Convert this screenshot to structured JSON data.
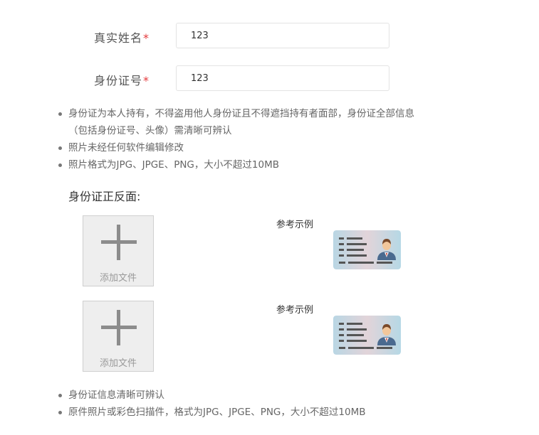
{
  "form": {
    "name_label": "真实姓名",
    "name_value": "123",
    "id_label": "身份证号",
    "id_value": "123",
    "required_mark": "*"
  },
  "notes_top": [
    "身份证为本人持有，不得盗用他人身份证且不得遮挡持有者面部，身份证全部信息（包括身份证号、头像）需清晰可辨认",
    "照片未经任何软件编辑修改",
    "照片格式为JPG、JPGE、PNG，大小不超过10MB"
  ],
  "section_title": "身份证正反面:",
  "uploads": [
    {
      "button_text": "添加文件",
      "example_label": "参考示例"
    },
    {
      "button_text": "添加文件",
      "example_label": "参考示例"
    }
  ],
  "notes_bottom": [
    "身份证信息清晰可辨认",
    "原件照片或彩色扫描件，格式为JPG、JPGE、PNG，大小不超过10MB"
  ],
  "colors": {
    "required": "#e4393c",
    "upload_bg": "#eeeeee",
    "plus": "#8c8c8c"
  },
  "icons": {
    "upload": "plus-icon",
    "example": "id-card-icon"
  }
}
